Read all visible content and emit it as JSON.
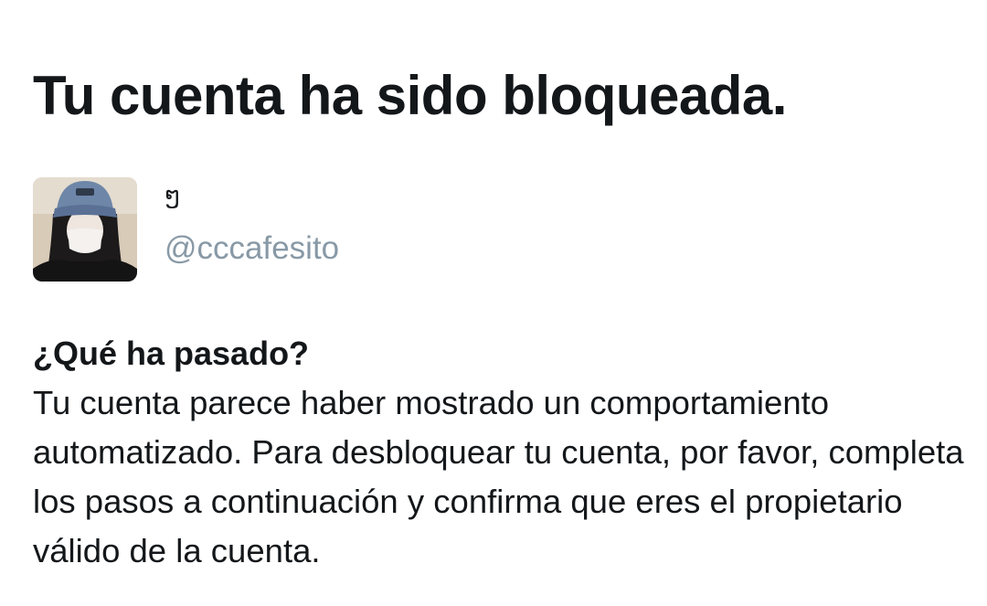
{
  "page": {
    "title": "Tu cuenta ha sido bloqueada."
  },
  "account": {
    "display_name": "ໆ",
    "handle": "@cccafesito",
    "avatar_icon": "user-avatar-photo"
  },
  "section": {
    "heading": "¿Qué ha pasado?",
    "body": "Tu cuenta parece haber mostrado un comportamiento automatizado. Para desbloquear tu cuenta, por favor, completa los pasos a continuación y confirma que eres el propietario válido de la cuenta."
  },
  "colors": {
    "text_primary": "#14171a",
    "text_secondary": "#8899a6",
    "background": "#ffffff"
  }
}
